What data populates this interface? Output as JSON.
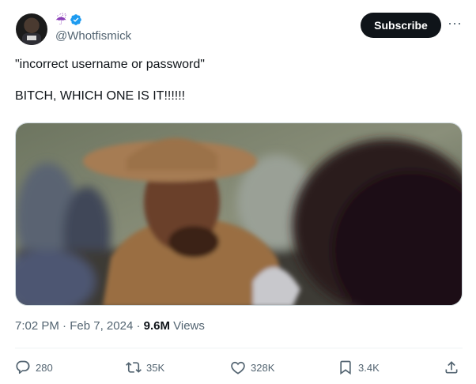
{
  "author": {
    "emoji": "☔",
    "handle": "@Whotfismick"
  },
  "subscribe_label": "Subscribe",
  "more_label": "···",
  "tweet": {
    "text": "\"incorrect username or password\"\n\nBITCH, WHICH ONE IS IT!!!!!!"
  },
  "meta": {
    "time": "7:02 PM",
    "separator1": " · ",
    "date": "Feb 7, 2024",
    "separator2": " · ",
    "views_count": "9.6M",
    "views_label": " Views"
  },
  "actions": {
    "replies": "280",
    "reposts": "35K",
    "likes": "328K",
    "bookmarks": "3.4K"
  },
  "colors": {
    "accent": "#1d9bf0",
    "text": "#0f1419",
    "muted": "#536471",
    "button_bg": "#0f1419"
  },
  "icons": [
    "verified-badge-icon",
    "more-icon",
    "reply-icon",
    "repost-icon",
    "like-icon",
    "bookmark-icon",
    "share-icon"
  ]
}
